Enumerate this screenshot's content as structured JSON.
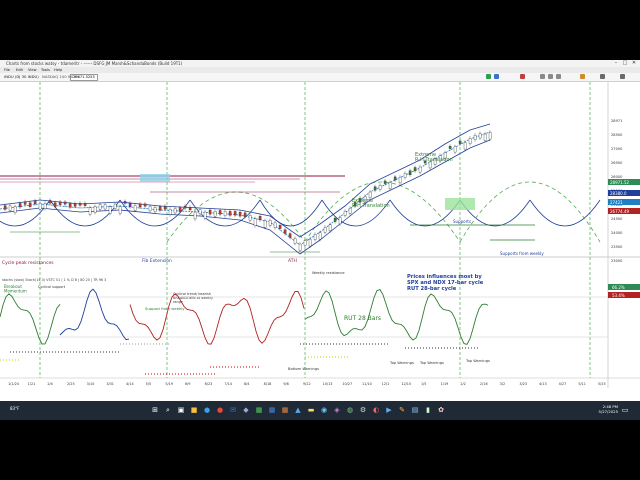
{
  "window": {
    "title": "Charts from stocks watsy - tdameritr - ------ DSFG JM Marsh&SchandaBonds (Build 19T1)",
    "minimize": "–",
    "maximize": "□",
    "close": "✕"
  },
  "menu": [
    "File",
    "Edit",
    "View",
    "Tools",
    "Help"
  ],
  "toolbar": {
    "symbol_label": "INDU (DJ 30 INDU)",
    "price_box": "29071.5253",
    "desc": "NASDAQ 100 INDEX"
  },
  "header_readout": "NDX | 3 TC 0 BALS | O 10 27.2 | H 0 28 8041 | L 28 88 | C 28971.5253 | ExtHrs 14 19 12.11 | ATH 28 18 | RVOL 0.03",
  "annotations": {
    "extreme_top": "Extreme\nR-H Translation",
    "extreme_mid": "Extreme\nR-H Translation",
    "cycle_peak": "Cycle peak resistances",
    "ath": "ATH",
    "support_weekly": "Support from weekly",
    "supports": "Supports",
    "supports_weekly2": "Supports from weekly",
    "prices_influences": "Prices influences most by\nSPX and NDX 17-bar cycle\nRUT 28-bar cycle",
    "rut_bars": "RUT 28 Bars",
    "fib_extension": "Fib Extension",
    "bottom_warnings": "Bottom Warnings",
    "top_warnings_1": "Top Warnings",
    "top_warnings_2": "Top Warnings",
    "top_warnings_3": "Top Warnings",
    "hedging": "hedging",
    "breakout": "Breakout\nMomentum",
    "cyclical_support": "Cyclical support",
    "left_label": "Cyclical trend / \nReaction",
    "cycle_hint": "Cyclical trend/ bearish\nBREAKDOWN at weekly\nrange",
    "mid_resist": "Weekly resistance",
    "oscillator_header": "stochs (slow) Stoch(14,3) VSTC S1 | 1 % D 8 | 80 20 | TR 96 3"
  },
  "price_scale": [
    "28971",
    "28500",
    "27000",
    "26500",
    "26000",
    "25500",
    "25000",
    "24500",
    "24000",
    "23500",
    "23000"
  ],
  "price_tags": [
    {
      "value": "28971.52",
      "color": "#2e8b57"
    },
    {
      "value": "28380.0",
      "color": "#1f3f9a"
    },
    {
      "value": "27421",
      "color": "#1e7fc1"
    },
    {
      "value": "26774.49",
      "color": "#b22222"
    }
  ],
  "osc_tags": [
    {
      "value": "66.2%",
      "color": "#2e8b57"
    },
    {
      "value": "53.4%",
      "color": "#b22222"
    }
  ],
  "date_axis": [
    "1/1/24",
    "1/21",
    "2/4",
    "2/25",
    "3/10",
    "3/31",
    "4/14",
    "5/5",
    "5/19",
    "6/9",
    "6/23",
    "7/14",
    "8/4",
    "8/18",
    "9/8",
    "9/22",
    "10/13",
    "10/27",
    "11/10",
    "12/1",
    "12/15",
    "1/5",
    "1/19",
    "2/2",
    "2/16",
    "3/2",
    "3/23",
    "4/13",
    "4/27",
    "5/11",
    "5/25"
  ],
  "taskbar": {
    "search_icon": "search-icon",
    "weather": "83°F",
    "time": "2:48 PM",
    "date": "5/27/2025"
  }
}
